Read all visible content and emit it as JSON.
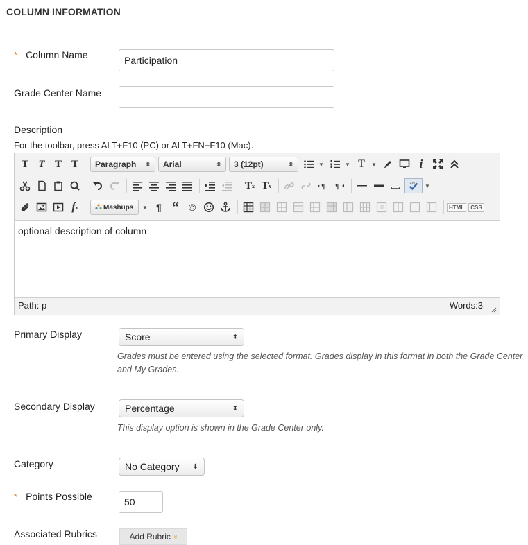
{
  "section": {
    "title": "COLUMN INFORMATION"
  },
  "fields": {
    "column_name": {
      "label": "Column Name",
      "required_mark": "*",
      "value": "Participation"
    },
    "grade_center_name": {
      "label": "Grade Center Name",
      "value": ""
    },
    "description": {
      "label": "Description",
      "hint": "For the toolbar, press ALT+F10 (PC) or ALT+FN+F10 (Mac).",
      "content": "optional description of column",
      "path": "Path: p",
      "words": "Words:3"
    },
    "primary_display": {
      "label": "Primary Display",
      "value": "Score",
      "help": "Grades must be entered using the selected format. Grades display in this format in both the Grade Center and My Grades."
    },
    "secondary_display": {
      "label": "Secondary Display",
      "value": "Percentage",
      "help": "This display option is shown in the Grade Center only."
    },
    "category": {
      "label": "Category",
      "value": "No Category"
    },
    "points_possible": {
      "label": "Points Possible",
      "required_mark": "*",
      "value": "50"
    },
    "rubrics": {
      "label": "Associated Rubrics",
      "button": "Add Rubric",
      "chevron": "»"
    }
  },
  "toolbar": {
    "format_select": "Paragraph",
    "font_select": "Arial",
    "size_select": "3 (12pt)",
    "mashups": "Mashups",
    "html_label": "HTML",
    "css_label": "CSS",
    "bold": "T",
    "italic": "T",
    "underline": "T",
    "strike": "T",
    "superscript": "T",
    "subscript": "T",
    "text_color": "T",
    "paragraph_mark": "¶",
    "quote": "“",
    "copyright": "©",
    "info": "i",
    "function": "f",
    "select_arrow": "⬍",
    "drop_arrow": "▼"
  },
  "colors": {
    "required": "#e8852a",
    "rubric_chevron": "#e8a23a"
  }
}
